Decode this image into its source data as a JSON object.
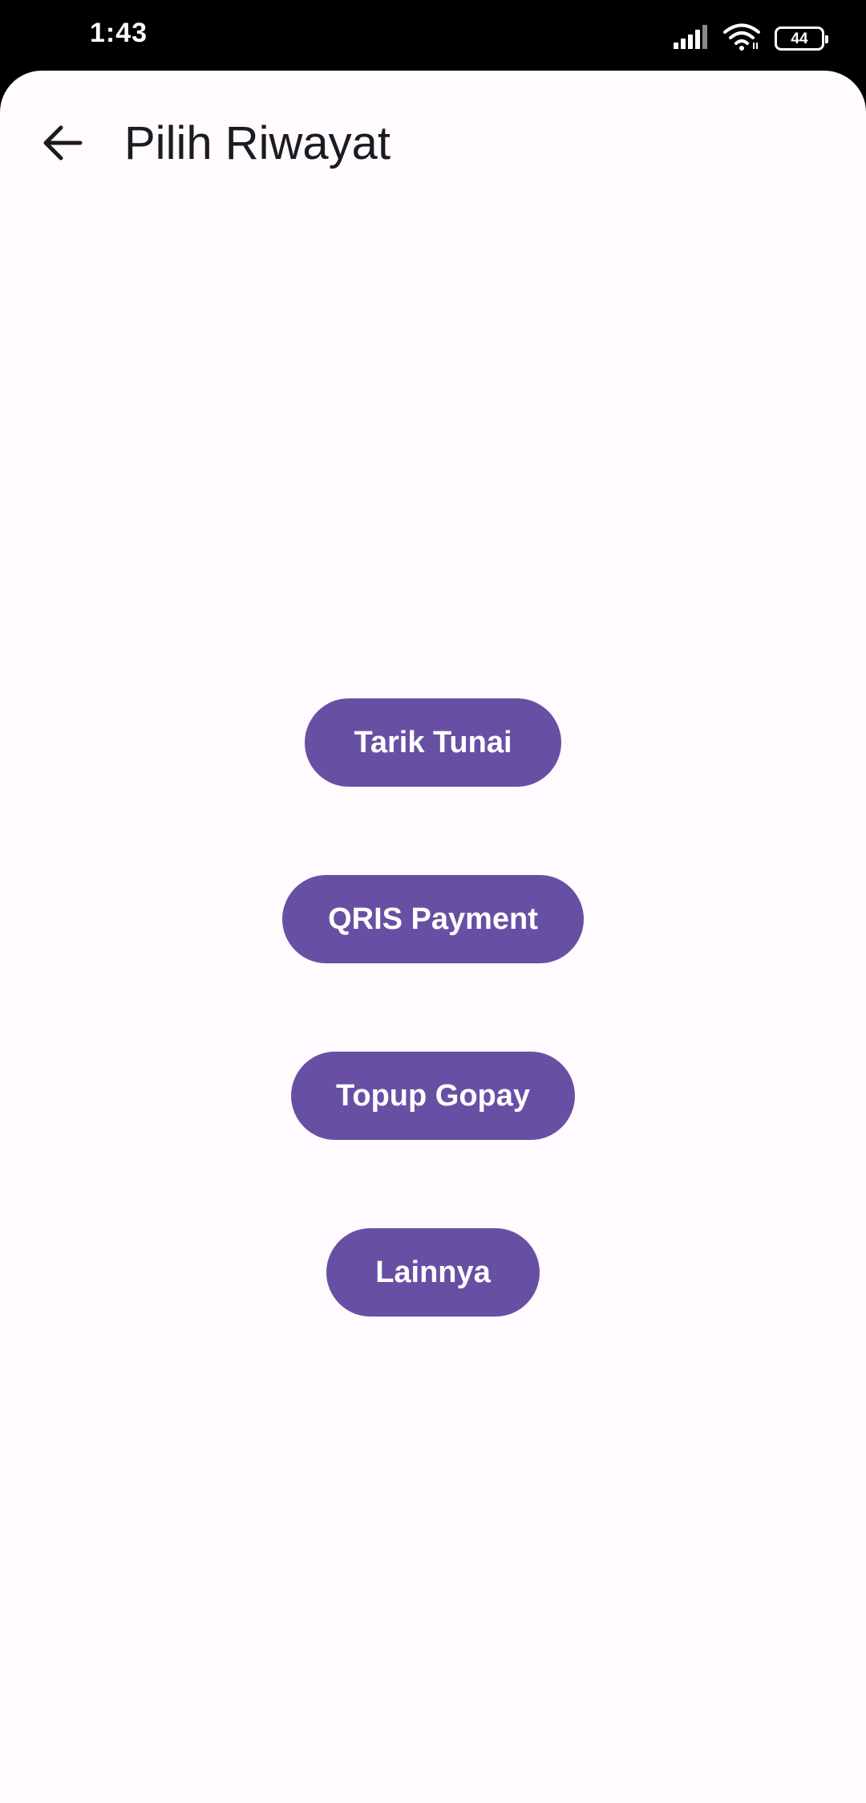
{
  "status_bar": {
    "time": "1:43",
    "battery_level": "44",
    "icons": [
      "signal-icon",
      "wifi-icon",
      "battery-icon"
    ]
  },
  "app_bar": {
    "back_icon": "arrow-left-icon",
    "title": "Pilih Riwayat"
  },
  "options": [
    {
      "label": "Tarik Tunai"
    },
    {
      "label": "QRIS Payment"
    },
    {
      "label": "Topup Gopay"
    },
    {
      "label": "Lainnya"
    }
  ],
  "colors": {
    "accent": "#6750a4",
    "background": "#fffbfe",
    "title_text": "#1c1b1f",
    "button_text": "#ffffff"
  }
}
